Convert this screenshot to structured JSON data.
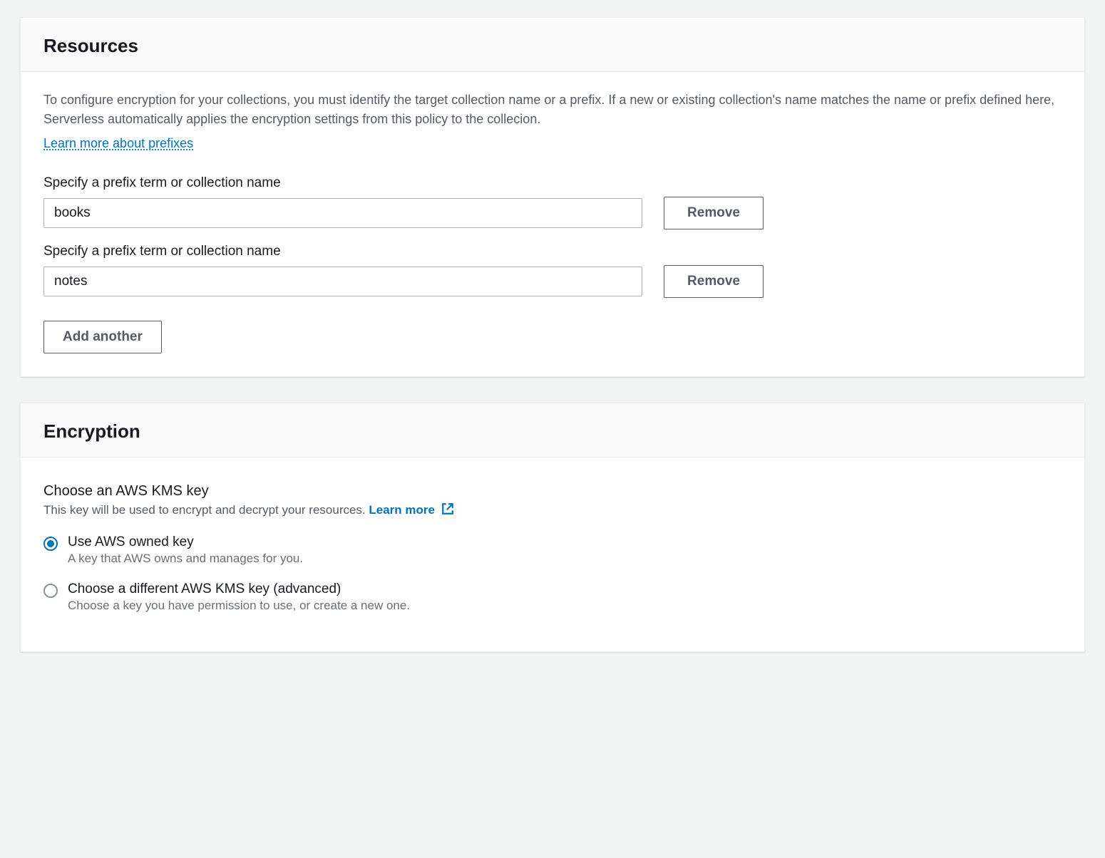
{
  "resources": {
    "title": "Resources",
    "description": "To configure encryption for your collections, you must identify the target collection name or a prefix. If a new or existing collection's name matches the name or prefix defined here, Serverless automatically applies the encryption settings from this policy to the collecion.",
    "learn_more_label": "Learn more about prefixes",
    "field_label": "Specify a prefix term or collection name",
    "items": [
      {
        "value": "books"
      },
      {
        "value": "notes"
      }
    ],
    "remove_label": "Remove",
    "add_another_label": "Add another"
  },
  "encryption": {
    "title": "Encryption",
    "choose_label": "Choose an AWS KMS key",
    "choose_sub": "This key will be used to encrypt and decrypt your resources.",
    "learn_more_label": "Learn more",
    "options": [
      {
        "title": "Use AWS owned key",
        "sub": "A key that AWS owns and manages for you.",
        "selected": true
      },
      {
        "title": "Choose a different AWS KMS key (advanced)",
        "sub": "Choose a key you have permission to use, or create a new one.",
        "selected": false
      }
    ]
  }
}
